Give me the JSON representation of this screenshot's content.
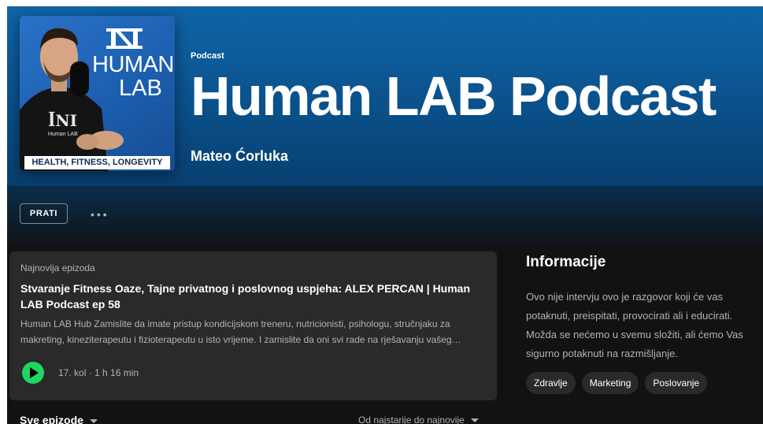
{
  "podcast": {
    "kind_label": "Podcast",
    "title": "Human LAB Podcast",
    "author": "Mateo Ćorluka"
  },
  "cover": {
    "line1": "HUMAN",
    "line2": "LAB",
    "strip": "HEALTH, FITNESS, LONGEVITY",
    "shirt_text": "Human LAB"
  },
  "actions": {
    "follow_label": "PRATI",
    "more_label": "•••"
  },
  "latest_episode": {
    "section_label": "Najnovija epizoda",
    "title": "Stvaranje Fitness Oaze, Tajne privatnog i poslovnog uspjeha: ALEX PERCAN | Human LAB Podcast ep 58",
    "description": "Human LAB Hub Zamislite da imate pristup kondicijskom treneru, nutricionisti, psihologu, stručnjaku za makreting, kineziterapeutu i fizioterapeutu u isto vrijeme. I zamislite da oni svi rade na rješavanju vašeg…",
    "date": "17. kol",
    "duration": "1 h 16 min",
    "meta": "17. kol · 1 h 16 min"
  },
  "info": {
    "heading": "Informacije",
    "text": "Ovo nije intervju ovo je razgovor koji će vas potaknuti, preispitati, provocirati ali i educirati. Možda se nećemo u svemu složiti, ali ćemo Vas sigurno potaknuti na razmišljanje.",
    "tags": [
      "Zdravlje",
      "Marketing",
      "Poslovanje"
    ]
  },
  "episodes_list": {
    "filter_label": "Sve epizode",
    "sort_label": "Od najstarije do najnovije"
  },
  "colors": {
    "accent_green": "#1ed760",
    "header_blue": "#0f65a8",
    "background": "#121212"
  },
  "icons": [
    "play-icon",
    "more-icon",
    "chevron-down-icon",
    "human-lab-logo"
  ]
}
